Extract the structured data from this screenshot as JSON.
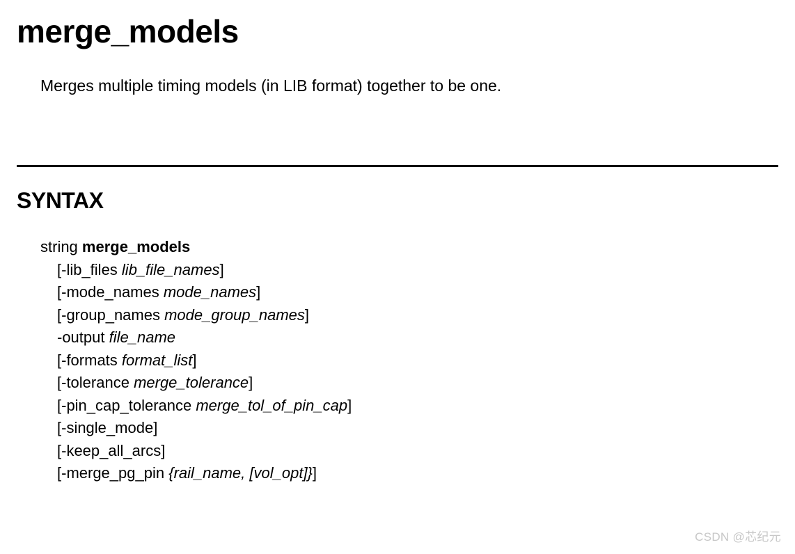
{
  "title": "merge_models",
  "description": "Merges multiple timing models (in LIB format) together to be one.",
  "section_heading": "SYNTAX",
  "syntax": {
    "return_type": "string",
    "command": "merge_models",
    "options": [
      {
        "prefix": "[-lib_files ",
        "arg": "lib_file_names",
        "suffix": "]"
      },
      {
        "prefix": "[-mode_names ",
        "arg": "mode_names",
        "suffix": "]"
      },
      {
        "prefix": "[-group_names ",
        "arg": "mode_group_names",
        "suffix": "]"
      },
      {
        "prefix": "-output ",
        "arg": "file_name",
        "suffix": ""
      },
      {
        "prefix": "[-formats ",
        "arg": "format_list",
        "suffix": "]"
      },
      {
        "prefix": "[-tolerance ",
        "arg": "merge_tolerance",
        "suffix": "]"
      },
      {
        "prefix": "[-pin_cap_tolerance ",
        "arg": "merge_tol_of_pin_cap",
        "suffix": "]"
      },
      {
        "prefix": "[-single_mode]",
        "arg": "",
        "suffix": ""
      },
      {
        "prefix": "[-keep_all_arcs]",
        "arg": "",
        "suffix": ""
      },
      {
        "prefix": "[-merge_pg_pin ",
        "arg": "{rail_name, [vol_opt]}",
        "suffix": "]"
      }
    ]
  },
  "watermark": "CSDN @芯纪元"
}
